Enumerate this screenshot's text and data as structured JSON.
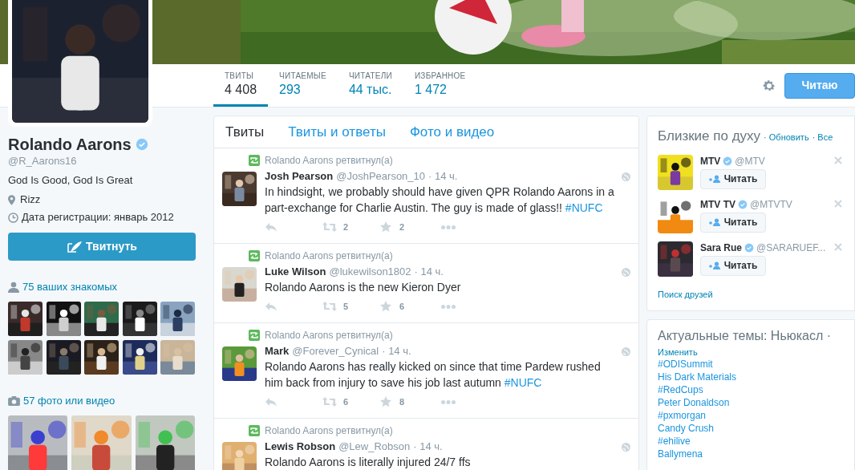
{
  "profile": {
    "name": "Rolando Aarons",
    "verified": true,
    "handle": "@R_Aarons16",
    "bio": "God Is Good, God Is Great",
    "location": "Rizz",
    "joined": "Дата регистрации: январь 2012",
    "tweet_button": "Твитнуть"
  },
  "stats": [
    {
      "label": "ТВИТЫ",
      "value": "4 408",
      "selected": true
    },
    {
      "label": "ЧИТАЕМЫЕ",
      "value": "293",
      "selected": false
    },
    {
      "label": "ЧИТАТЕЛИ",
      "value": "44 тыс.",
      "selected": false
    },
    {
      "label": "ИЗБРАННОЕ",
      "value": "1 472",
      "selected": false
    }
  ],
  "follow_button": "Читаю",
  "friends": {
    "label": "75 ваших знакомых"
  },
  "media": {
    "label": "57 фото или видео"
  },
  "content_tabs": [
    {
      "label": "Твиты",
      "selected": true
    },
    {
      "label": "Твиты и ответы",
      "selected": false
    },
    {
      "label": "Фото и видео",
      "selected": false
    }
  ],
  "tweets": [
    {
      "context": "Rolando Aarons ретвитнул(а)",
      "name": "Josh Pearson",
      "handle": "@JoshPearson_10",
      "time": "· 14 ч.",
      "text": "In hindsight, we probably should have given QPR Rolando Aarons in a part-exchange for Charlie Austin. The guy is made of glass!!",
      "hashtag": "#NUFC",
      "retweets": "2",
      "likes": "2"
    },
    {
      "context": "Rolando Aarons ретвитнул(а)",
      "name": "Luke Wilson",
      "handle": "@lukewilson1802",
      "time": "· 14 ч.",
      "text": "Rolando Aarons is the new Kieron Dyer",
      "retweets": "5",
      "likes": "6"
    },
    {
      "context": "Rolando Aarons ретвитнул(а)",
      "name": "Mark",
      "handle": "@Forever_Cynical",
      "time": "· 14 ч.",
      "text": "Rolando Aarons has really kicked on since that time Pardew rushed him back from injury to save his job last autumn",
      "hashtag": "#NUFC",
      "retweets": "6",
      "likes": "8"
    },
    {
      "context": "Rolando Aarons ретвитнул(а)",
      "name": "Lewis Robson",
      "handle": "@Lew_Robson",
      "time": "· 14 ч.",
      "text": "Rolando Aarons is literally injured 24/7 ffs"
    }
  ],
  "who_to_follow": {
    "title": "Близкие по духу",
    "refresh": "· Обновить",
    "all": "· Все",
    "accounts": [
      {
        "name": "MTV",
        "verified": true,
        "handle": "@MTV",
        "follow": "Читать"
      },
      {
        "name": "MTV TV",
        "verified": true,
        "handle": "@MTVTV",
        "follow": "Читать"
      },
      {
        "name": "Sara Rue",
        "verified": true,
        "handle": "@SARARUEF...",
        "follow": "Читать"
      }
    ],
    "find_friends": "Поиск друзей"
  },
  "trends": {
    "title": "Актуальные темы: Ньюкасл ·",
    "change": "Изменить",
    "items": [
      "#ODISummit",
      "His Dark Materials",
      "#RedCups",
      "Peter Donaldson",
      "#pxmorgan",
      "Candy Crush",
      "#ehilive",
      "Ballymena"
    ]
  }
}
